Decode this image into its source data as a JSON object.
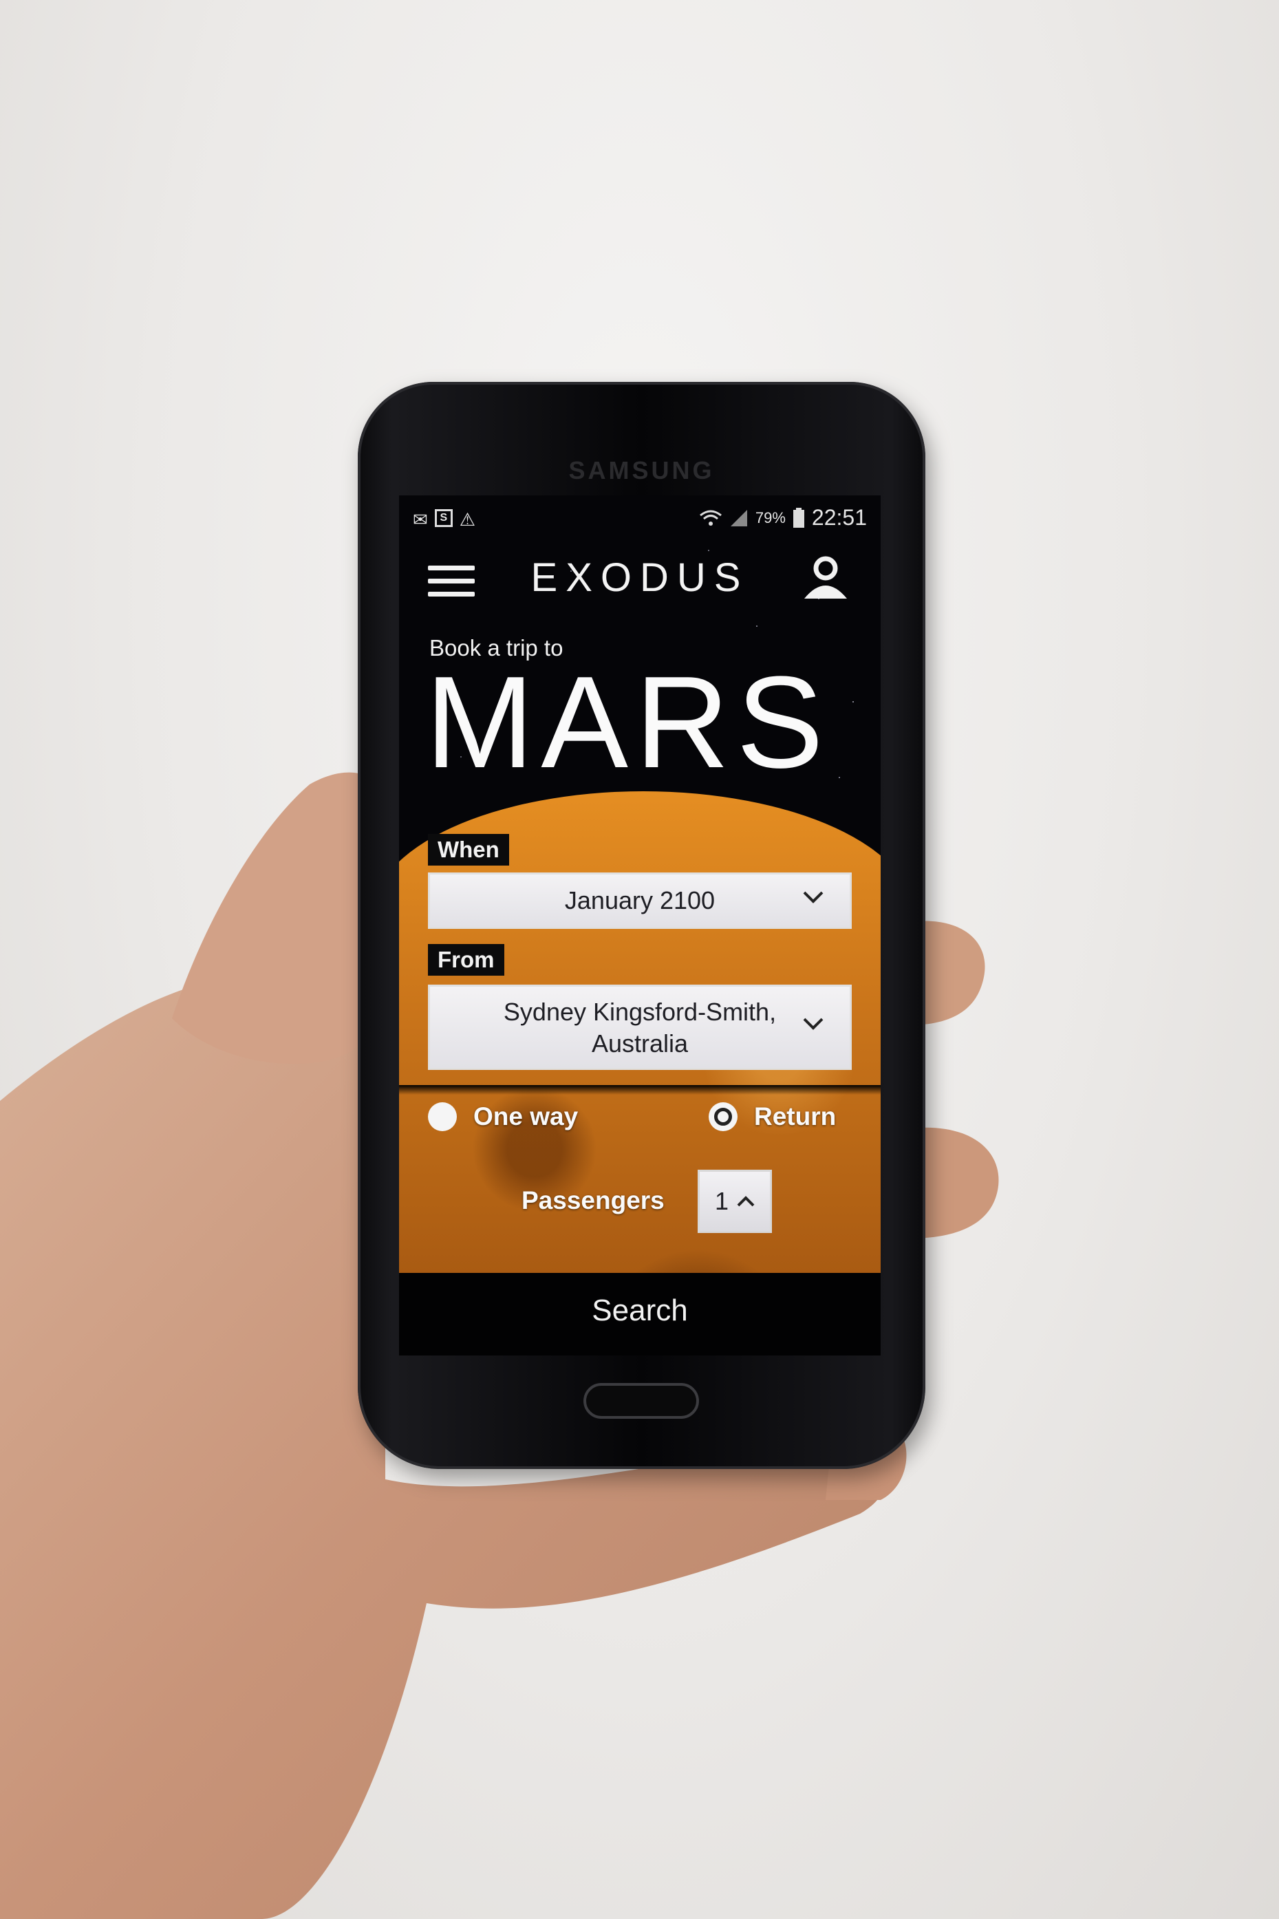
{
  "device": {
    "brand": "SAMSUNG"
  },
  "status_bar": {
    "battery": "79%",
    "time": "22:51",
    "icons": [
      "mail-icon",
      "s-icon",
      "warning-icon",
      "wifi-icon",
      "signal-icon",
      "battery-icon"
    ]
  },
  "header": {
    "logo": "EXODUS",
    "menu_icon": "hamburger-menu-icon",
    "account_icon": "user-icon"
  },
  "hero": {
    "kicker": "Book a trip to",
    "destination": "MARS"
  },
  "form": {
    "when": {
      "label": "When",
      "value": "January 2100"
    },
    "from": {
      "label": "From",
      "value_line1": "Sydney Kingsford-Smith,",
      "value_line2": "Australia"
    },
    "trip_type": {
      "options": [
        {
          "label": "One way",
          "selected": false
        },
        {
          "label": "Return",
          "selected": true
        }
      ]
    },
    "passengers": {
      "label": "Passengers",
      "value": "1"
    }
  },
  "actions": {
    "search_label": "Search"
  },
  "colors": {
    "screen_bg": "#050508",
    "planet": "#c9741a",
    "text": "#f4f4f4",
    "field_bg": "#ecebef"
  }
}
